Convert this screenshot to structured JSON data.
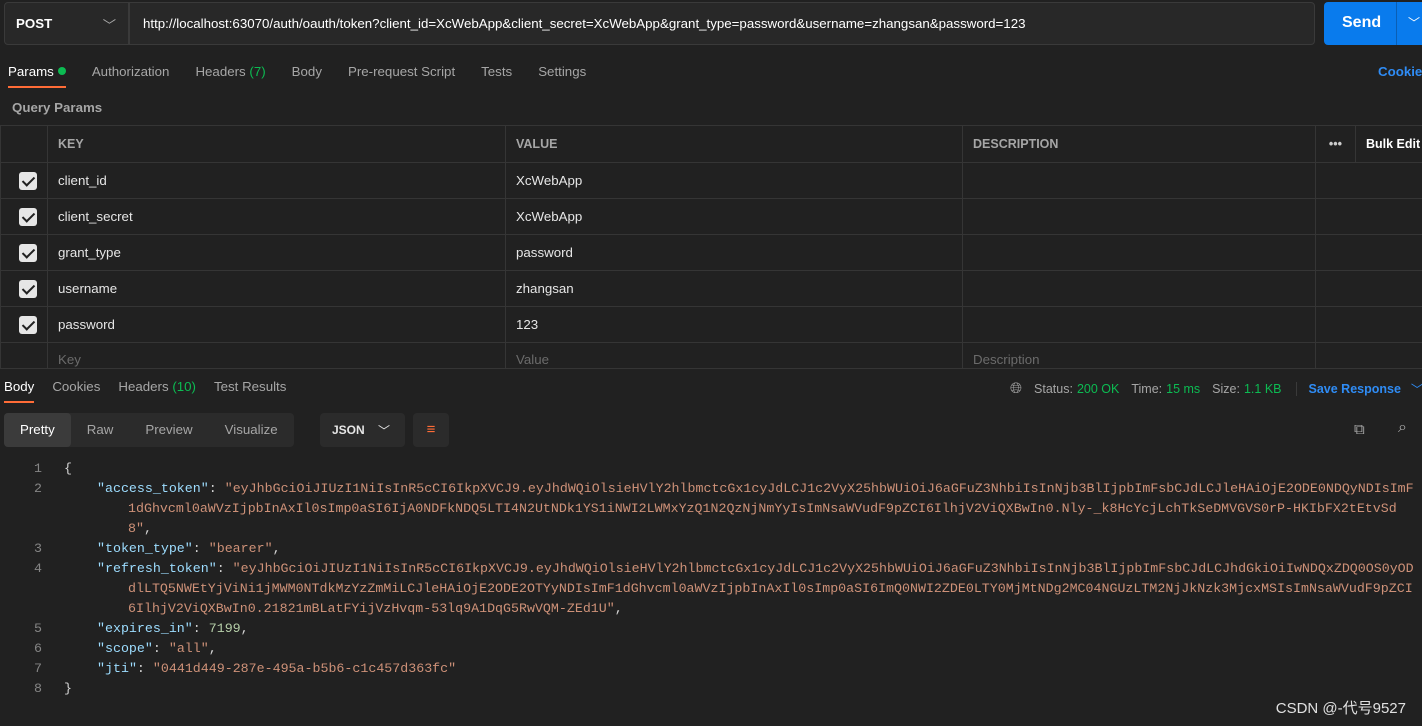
{
  "request": {
    "method": "POST",
    "url": "http://localhost:63070/auth/oauth/token?client_id=XcWebApp&client_secret=XcWebApp&grant_type=password&username=zhangsan&password=123",
    "send_label": "Send"
  },
  "req_tabs": {
    "params": "Params",
    "authorization": "Authorization",
    "headers": "Headers",
    "headers_count": "(7)",
    "body": "Body",
    "prerequest": "Pre-request Script",
    "tests": "Tests",
    "settings": "Settings",
    "cookies": "Cookies"
  },
  "query_params": {
    "title": "Query Params",
    "headers": {
      "key": "KEY",
      "value": "VALUE",
      "description": "DESCRIPTION",
      "bulk_edit": "Bulk Edit"
    },
    "rows": [
      {
        "key": "client_id",
        "value": "XcWebApp",
        "checked": true
      },
      {
        "key": "client_secret",
        "value": "XcWebApp",
        "checked": true
      },
      {
        "key": "grant_type",
        "value": "password",
        "checked": true
      },
      {
        "key": "username",
        "value": "zhangsan",
        "checked": true
      },
      {
        "key": "password",
        "value": "123",
        "checked": true
      }
    ],
    "placeholder": {
      "key": "Key",
      "value": "Value",
      "description": "Description"
    }
  },
  "response": {
    "tabs": {
      "body": "Body",
      "cookies": "Cookies",
      "headers": "Headers",
      "headers_count": "(10)",
      "test_results": "Test Results"
    },
    "status_label": "Status:",
    "status": "200 OK",
    "time_label": "Time:",
    "time": "15 ms",
    "size_label": "Size:",
    "size": "1.1 KB",
    "save": "Save Response",
    "views": [
      "Pretty",
      "Raw",
      "Preview",
      "Visualize"
    ],
    "format": "JSON",
    "json": {
      "access_token": "eyJhbGciOiJIUzI1NiIsInR5cCI6IkpXVCJ9.eyJhdWQiOlsieHVlY2hlbmctcGx1cyJdLCJ1c2VyX25hbWUiOiJ6aGFuZ3NhbiIsInNjb3BlIjpbImFsbCJdLCJleHAiOjE2ODE0NDQyNDIsImF1dGhvcml0aWVzIjpbInAxIl0sImp0aSI6IjA0NDFkNDQ5LTI4N2UtNDk1YS1iNWI2LWMxYzQ1N2QzNjNmYyIsImNsaWVudF9pZCI6IlhjV2ViQXBwIn0.Nly-_k8HcYcjLchTkSeDMVGVS0rP-HKIbFX2tEtvSd8",
      "token_type": "bearer",
      "refresh_token": "eyJhbGciOiJIUzI1NiIsInR5cCI6IkpXVCJ9.eyJhdWQiOlsieHVlY2hlbmctcGx1cyJdLCJ1c2VyX25hbWUiOiJ6aGFuZ3NhbiIsInNjb3BlIjpbImFsbCJdLCJhdGkiOiIwNDQxZDQ0OS0yODdlLTQ5NWEtYjViNi1jMWM0NTdkMzYzZmMiLCJleHAiOjE2ODE2OTYyNDIsImF1dGhvcml0aWVzIjpbInAxIl0sImp0aSI6ImQ0NWI2ZDE0LTY0MjMtNDg2MC04NGUzLTM2NjJkNzk3MjcxMSIsImNsaWVudF9pZCI6IlhjV2ViQXBwIn0.21821mBLatFYijVzHvqm-53lq9A1DqG5RwVQM-ZEd1U",
      "expires_in": 7199,
      "scope": "all",
      "jti": "0441d449-287e-495a-b5b6-c1c457d363fc"
    }
  },
  "watermark": "CSDN @-代号9527"
}
